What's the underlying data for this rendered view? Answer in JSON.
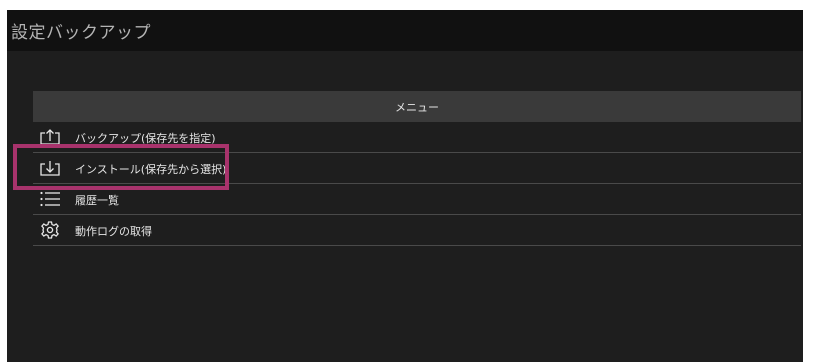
{
  "window": {
    "title": "設定バックアップ"
  },
  "menu": {
    "header": "メニュー",
    "items": [
      {
        "label": "バックアップ(保存先を指定)",
        "icon": "upload-icon"
      },
      {
        "label": "インストール(保存先から選択)",
        "icon": "download-icon"
      },
      {
        "label": "履歴一覧",
        "icon": "list-icon"
      },
      {
        "label": "動作ログの取得",
        "icon": "gear-icon"
      }
    ]
  },
  "colors": {
    "background": "#1e1e1e",
    "titlebar": "#111111",
    "header_bar": "#3a3a3a",
    "text": "#e6e6e6",
    "highlight": "#a8336c"
  }
}
